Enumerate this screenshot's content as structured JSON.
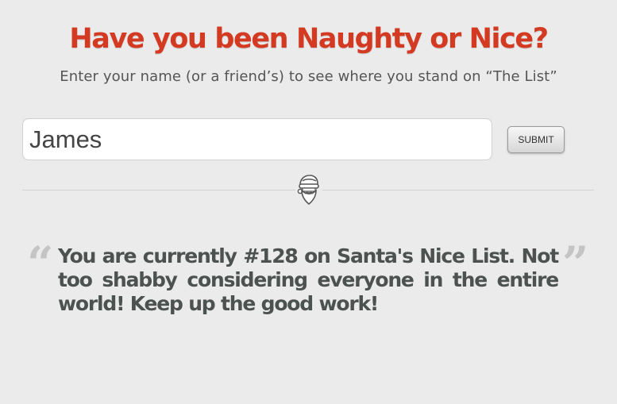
{
  "header": {
    "title": "Have you been Naughty or Nice?",
    "subtitle": "Enter your name (or a friend’s) to see where you stand on “The List”"
  },
  "form": {
    "name_value": "James",
    "submit_label": "SUBMIT"
  },
  "divider": {
    "icon": "santa-icon"
  },
  "result": {
    "quote_open": "“",
    "quote_close": "”",
    "text": "You are currently #128 on Santa's Nice List. Not too shabby considering everyone in the entire world! Keep up the good work!"
  },
  "colors": {
    "background": "#ebebeb",
    "title": "#d43a21",
    "result_text": "#4b524f"
  }
}
